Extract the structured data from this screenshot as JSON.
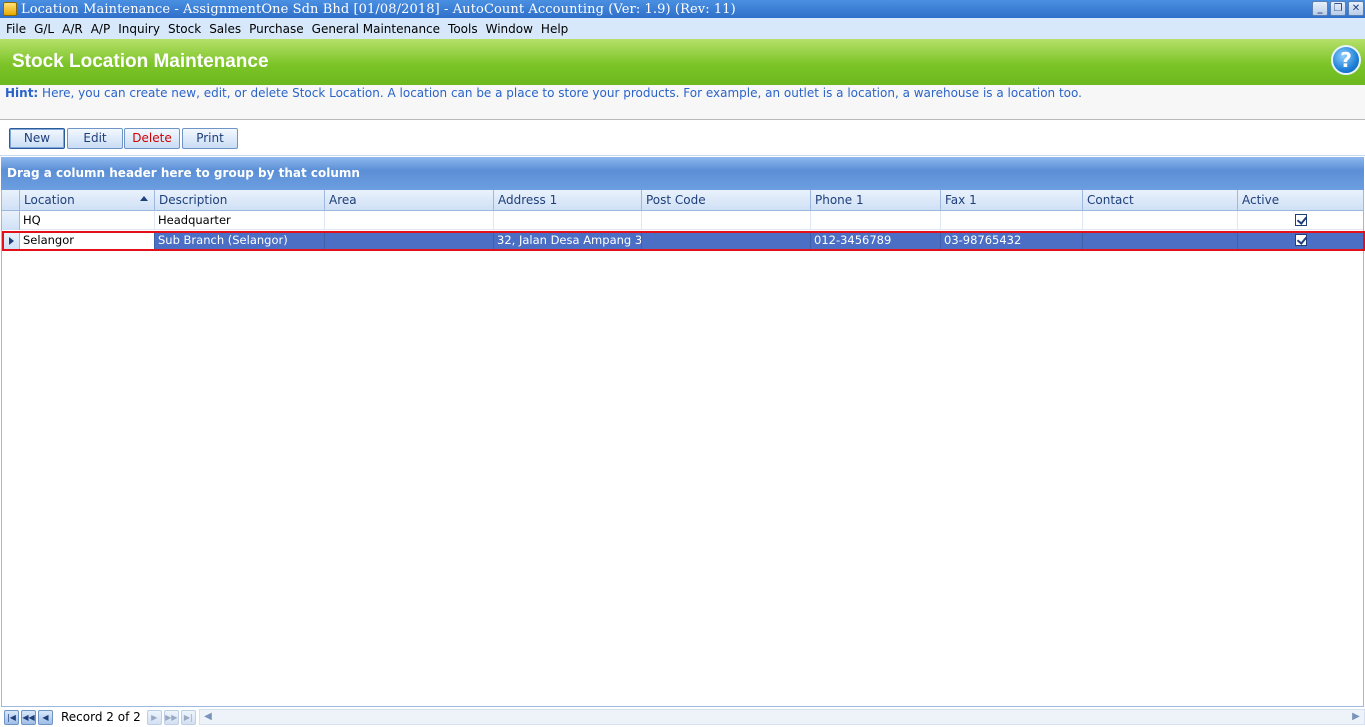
{
  "window": {
    "title": "Location Maintenance - AssignmentOne Sdn Bhd [01/08/2018] - AutoCount Accounting (Ver: 1.9) (Rev: 11)",
    "controls": [
      "_",
      "❐",
      "✕"
    ]
  },
  "menu": [
    "File",
    "G/L",
    "A/R",
    "A/P",
    "Inquiry",
    "Stock",
    "Sales",
    "Purchase",
    "General Maintenance",
    "Tools",
    "Window",
    "Help"
  ],
  "header": {
    "title": "Stock Location Maintenance",
    "help_glyph": "?"
  },
  "hint": {
    "label": "Hint:",
    "text": " Here, you can create new, edit, or delete Stock Location. A location can be a place to store your products. For example, an outlet is a location, a warehouse is a location too."
  },
  "toolbar": {
    "new_label": "New",
    "edit_label": "Edit",
    "delete_label": "Delete",
    "print_label": "Print"
  },
  "grid": {
    "group_prompt": "Drag a column header here to group by that column",
    "columns": [
      "Location",
      "Description",
      "Area",
      "Address 1",
      "Post Code",
      "Phone 1",
      "Fax 1",
      "Contact",
      "Active"
    ],
    "rows": [
      {
        "location": "HQ",
        "description": "Headquarter",
        "area": "",
        "address1": "",
        "postcode": "",
        "phone1": "",
        "fax1": "",
        "contact": "",
        "active": true
      },
      {
        "location": "Selangor",
        "description": "Sub Branch (Selangor)",
        "area": "",
        "address1": "32, Jalan Desa Ampang 3,",
        "postcode": "",
        "phone1": "012-3456789",
        "fax1": "03-98765432",
        "contact": "",
        "active": true
      }
    ],
    "selected_row": 2
  },
  "navigator": {
    "record_text": "Record 2 of 2"
  },
  "colors": {
    "banner_green": "#7cc428",
    "selection_blue": "#4a6fc4",
    "selection_outline": "#e3101a",
    "hint_blue": "#2a64c8",
    "delete_red": "#d00000"
  }
}
